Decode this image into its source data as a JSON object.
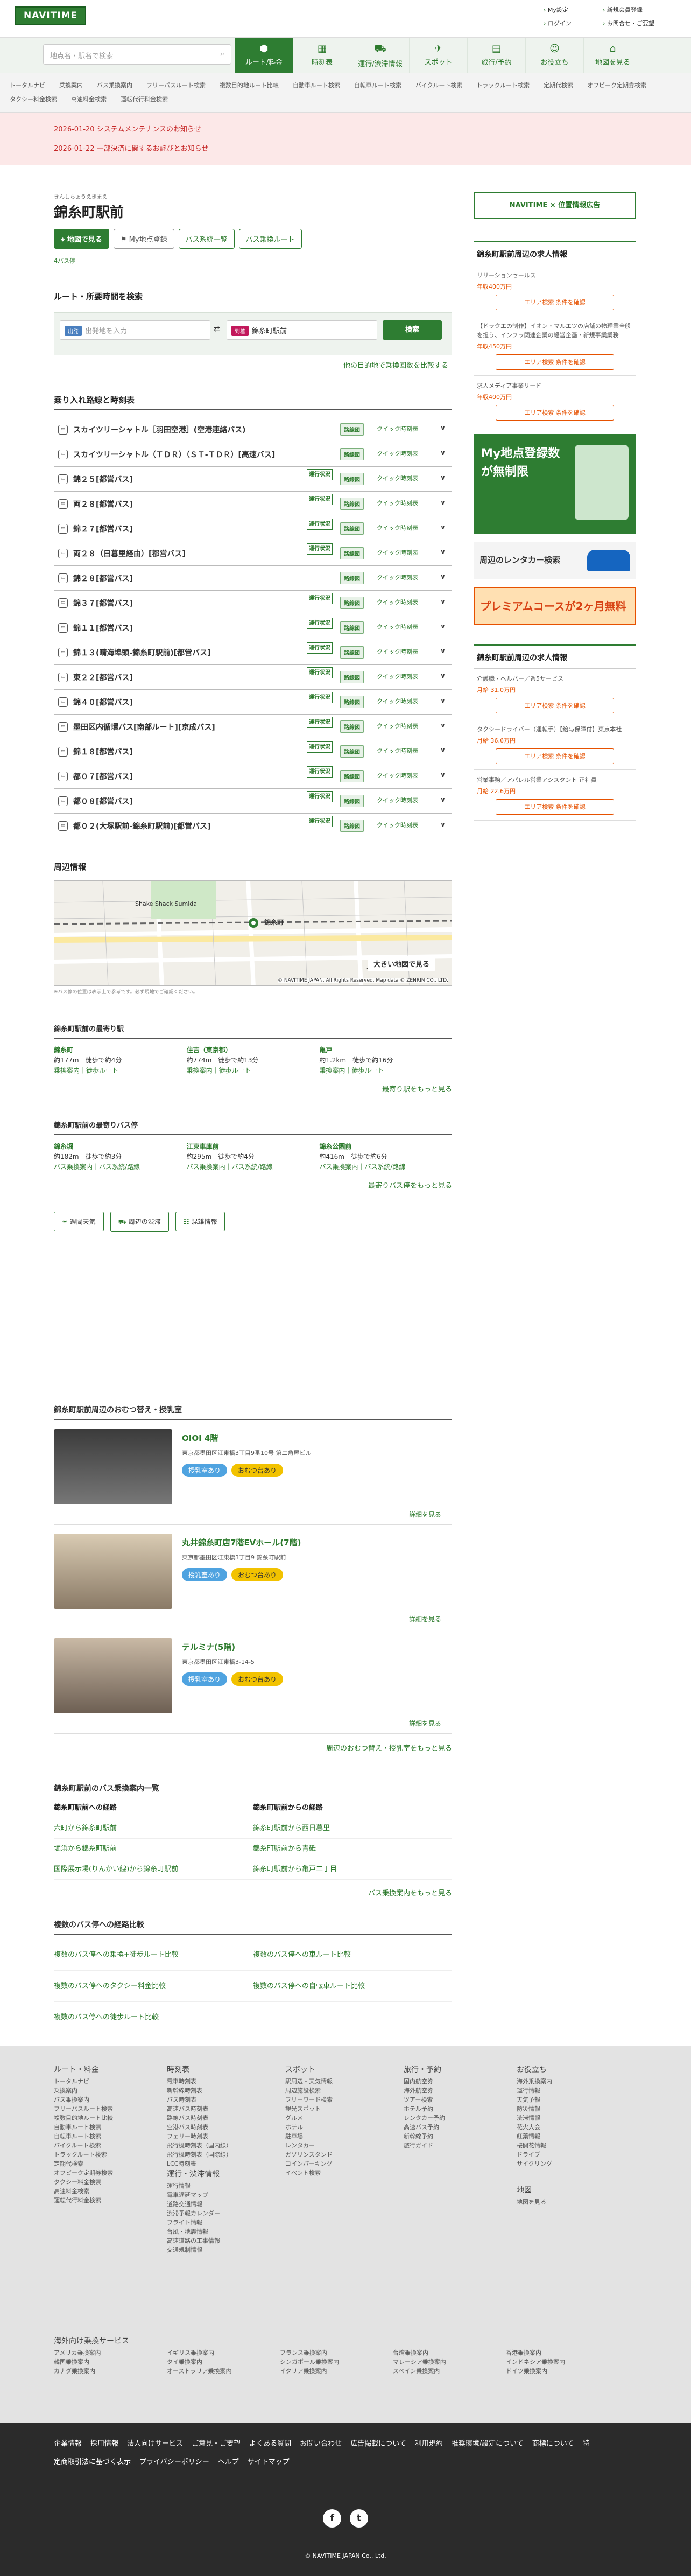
{
  "header": {
    "logo": "NAVITIME",
    "links": [
      "My設定",
      "新規会員登録",
      "ログイン",
      "お問合せ・ご要望"
    ]
  },
  "search": {
    "placeholder": "地点名・駅名で検索"
  },
  "nav": [
    {
      "label": "ルート/料金",
      "icon": "route-icon"
    },
    {
      "label": "時刻表",
      "icon": "timetable-icon"
    },
    {
      "label": "運行/渋滞情報",
      "icon": "traffic-icon"
    },
    {
      "label": "スポット",
      "icon": "spot-icon"
    },
    {
      "label": "旅行/予約",
      "icon": "travel-icon"
    },
    {
      "label": "お役立ち",
      "icon": "useful-icon"
    },
    {
      "label": "地図を見る",
      "icon": "map-icon"
    }
  ],
  "subnav": [
    "トータルナビ",
    "乗換案内",
    "バス乗換案内",
    "フリーパスルート検索",
    "複数目的地ルート比較",
    "自動車ルート検索",
    "自転車ルート検索",
    "バイクルート検索",
    "トラックルート検索",
    "定期代検索",
    "オフピーク定期券検索",
    "タクシー料金検索",
    "高速料金検索",
    "運転代行料金検索"
  ],
  "notices": [
    "2026-01-20 システムメンテナンスのお知らせ",
    "2026-01-22 一部決済に関するお詫びとお知らせ"
  ],
  "station": {
    "ruby": "きんしちょうえきまえ",
    "name": "錦糸町駅前",
    "btn_map": "地図で見る",
    "btn_my": "My地点登録",
    "btn_bus1": "バス系統一覧",
    "btn_bus2": "バス乗換ルート",
    "sub_link": "4バス停"
  },
  "route_search": {
    "title": "ルート・所要時間を検索",
    "from_tag": "出発",
    "from_ph": "出発地を入力",
    "to_tag": "到着",
    "to_val": "錦糸町駅前",
    "search": "検索",
    "compare": "他の目的地で乗換回数を比較する"
  },
  "lines_title": "乗り入れ路線と時刻表",
  "lines": [
    {
      "name": "スカイツリーシャトル［羽田空港］(空港連絡バス)",
      "ops": false
    },
    {
      "name": "スカイツリーシャトル（ＴＤＲ）（ＳＴ-ＴＤＲ）[高速バス]",
      "ops": false
    },
    {
      "name": "錦２５[都営バス]",
      "ops": true
    },
    {
      "name": "両２８[都営バス]",
      "ops": true
    },
    {
      "name": "錦２７[都営バス]",
      "ops": true
    },
    {
      "name": "両２８（日暮里経由）[都営バス]",
      "ops": true
    },
    {
      "name": "錦２８[都営バス]",
      "ops": false
    },
    {
      "name": "錦３７[都営バス]",
      "ops": true
    },
    {
      "name": "錦１１[都営バス]",
      "ops": true
    },
    {
      "name": "錦１３(晴海埠頭-錦糸町駅前)[都営バス]",
      "ops": true
    },
    {
      "name": "東２２[都営バス]",
      "ops": true
    },
    {
      "name": "錦４０[都営バス]",
      "ops": true
    },
    {
      "name": "墨田区内循環バス[南部ルート][京成バス]",
      "ops": true
    },
    {
      "name": "錦１８[都営バス]",
      "ops": true
    },
    {
      "name": "都０７[都営バス]",
      "ops": true
    },
    {
      "name": "都０８[都営バス]",
      "ops": true
    },
    {
      "name": "都０２(大塚駅前-錦糸町駅前)[都営バス]",
      "ops": true
    }
  ],
  "line_labels": {
    "ops": "運行状況",
    "sm": "路線図",
    "tt": "クイック時刻表",
    "cv": "∨"
  },
  "map": {
    "title": "周辺情報",
    "label1": "錦糸町",
    "label2": "Shake Shack Sumida",
    "label3": "大横",
    "bigbtn": "大きい地図で見る",
    "copyright": "© NAVITIME JAPAN, All Rights Reserved. Map data © ZENRIN CO., LTD.",
    "note": "※バス停の位置は表示上で参考です。必ず現地でご確認ください。"
  },
  "near_stations": {
    "title": "錦糸町駅前の最寄り駅",
    "items": [
      {
        "name": "錦糸町",
        "dist": "約177m　徒歩で約4分",
        "links": "乗換案内｜徒歩ルート"
      },
      {
        "name": "住吉（東京都）",
        "dist": "約774m　徒歩で約13分",
        "links": "乗換案内｜徒歩ルート"
      },
      {
        "name": "亀戸",
        "dist": "約1.2km　徒歩で約16分",
        "links": "乗換案内｜徒歩ルート"
      }
    ],
    "more": "最寄り駅をもっと見る"
  },
  "near_busstops": {
    "title": "錦糸町駅前の最寄りバス停",
    "items": [
      {
        "name": "錦糸堀",
        "dist": "約182m　徒歩で約3分",
        "links": "バス乗換案内｜バス系統/路線"
      },
      {
        "name": "江東車庫前",
        "dist": "約295m　徒歩で約4分",
        "links": "バス乗換案内｜バス系統/路線"
      },
      {
        "name": "錦糸公園前",
        "dist": "約416m　徒歩で約6分",
        "links": "バス乗換案内｜バス系統/路線"
      }
    ],
    "more": "最寄りバス停をもっと見る"
  },
  "info_buttons": [
    "週間天気",
    "周辺の渋滞",
    "混雑情報"
  ],
  "nursing": {
    "title": "錦糸町駅前周辺のおむつ替え・授乳室",
    "items": [
      {
        "name": "OIOI 4階",
        "addr": "東京都墨田区江東橋3丁目9番10号 第二角屋ビル"
      },
      {
        "name": "丸井錦糸町店7階EVホール(7階)",
        "addr": "東京都墨田区江東橋3丁目9 錦糸町駅前"
      },
      {
        "name": "テルミナ(5階)",
        "addr": "東京都墨田区江東橋3-14-5"
      }
    ],
    "tag1": "授乳室あり",
    "tag2": "おむつ台あり",
    "detail": "詳細を見る",
    "more": "周辺のおむつ替え・授乳室をもっと見る"
  },
  "bus_routes": {
    "title": "錦糸町駅前のバス乗換案内一覧",
    "h1": "錦糸町駅前への経路",
    "h2": "錦糸町駅前からの経路",
    "to": [
      "六町から錦糸町駅前",
      "堀浜から錦糸町駅前",
      "国際展示場(りんかい線)から錦糸町駅前"
    ],
    "from": [
      "錦糸町駅前から西日暮里",
      "錦糸町駅前から青砥",
      "錦糸町駅前から亀戸二丁目"
    ],
    "more": "バス乗換案内をもっと見る"
  },
  "multi": {
    "title": "複数のバス停への経路比較",
    "items": [
      "複数のバス停への乗換+徒歩ルート比較",
      "複数のバス停への車ルート比較",
      "複数のバス停へのタクシー料金比較",
      "複数のバス停への自転車ルート比較",
      "複数のバス停への徒歩ルート比較"
    ]
  },
  "side": {
    "ad_title": "NAVITIME × 位置情報広告",
    "jobs_title": "錦糸町駅前周辺の求人情報",
    "jobs": [
      {
        "desc": "リリーションセールス",
        "pay": "年収400万円"
      },
      {
        "desc": "【ドラクエの制作】イオン・マルエツの店舗の物理業全般を担う、インフラ関連企業の経営企画・新規事業業務",
        "pay": "年収450万円"
      },
      {
        "desc": "求人メディア事業リード",
        "pay": "年収400万円"
      }
    ],
    "jb": "エリア検索 条件を確認",
    "ad2": "My地点登録数が無制限",
    "ad3": "周辺のレンタカー検索",
    "ad4": "プレミアムコースが2ヶ月無料",
    "jobs2_title": "錦糸町駅前周辺の求人情報",
    "jobs2": [
      {
        "desc": "介護職・ヘルパー／週5サービス",
        "pay": "月給 31.0万円"
      },
      {
        "desc": "タクシードライバー（運転手）【給与保障付】東京本社",
        "pay": "月給 36.6万円"
      },
      {
        "desc": "営業事務／アパレル営業アシスタント 正社員",
        "pay": "月給 22.6万円"
      }
    ]
  },
  "footer": {
    "cols": [
      {
        "h": "ルート・料金",
        "items": [
          "トータルナビ",
          "乗換案内",
          "バス乗換案内",
          "フリーパスルート検索",
          "複数目的地ルート比較",
          "自動車ルート検索",
          "自転車ルート検索",
          "バイクルート検索",
          "トラックルート検索",
          "定期代検索",
          "オフピーク定期券検索",
          "タクシー料金検索",
          "高速料金検索",
          "運転代行料金検索"
        ]
      },
      {
        "h": "時刻表",
        "items": [
          "電車時刻表",
          "新幹線時刻表",
          "バス時刻表",
          "高速バス時刻表",
          "路線バス時刻表",
          "空港バス時刻表",
          "フェリー時刻表",
          "飛行機時刻表（国内線）",
          "飛行機時刻表（国際線）",
          "LCC時刻表"
        ]
      },
      {
        "h": "スポット",
        "items": [
          "駅周辺・天気情報",
          "周辺施設検索",
          "フリーワード検索",
          "観光スポット",
          "グルメ",
          "ホテル",
          "駐車場",
          "レンタカー",
          "ガソリンスタンド",
          "コインパーキング",
          "イベント検索"
        ]
      },
      {
        "h": "旅行・予約",
        "items": [
          "国内航空券",
          "海外航空券",
          "ツアー検索",
          "ホテル予約",
          "レンタカー予約",
          "高速バス予約",
          "新幹線予約",
          "旅行ガイド"
        ]
      },
      {
        "h": "お役立ち",
        "items": [
          "海外乗換案内",
          "運行情報",
          "天気予報",
          "防災情報",
          "渋滞情報",
          "花火大会",
          "紅葉情報",
          "桜開花情報",
          "ドライブ",
          "サイクリング"
        ]
      }
    ],
    "col2b": {
      "h": "運行・渋滞情報",
      "items": [
        "運行情報",
        "電車遅延マップ",
        "道路交通情報",
        "渋滞予報カレンダー",
        "フライト情報",
        "台風・地震情報",
        "高速道路の工事情報",
        "交通規制情報"
      ]
    },
    "map": {
      "h": "地図",
      "items": [
        "地図を見る"
      ]
    },
    "overseas": {
      "h": "海外向け乗換サービス",
      "items": [
        "アメリカ乗換案内",
        "イギリス乗換案内",
        "フランス乗換案内",
        "台湾乗換案内",
        "香港乗換案内",
        "韓国乗換案内",
        "タイ乗換案内",
        "シンガポール乗換案内",
        "マレーシア乗換案内",
        "インドネシア乗換案内",
        "カナダ乗換案内",
        "オーストラリア乗換案内",
        "イタリア乗換案内",
        "スペイン乗換案内",
        "ドイツ乗換案内"
      ]
    },
    "links": [
      "企業情報",
      "採用情報",
      "法人向けサービス",
      "ご意見・ご要望",
      "よくある質問",
      "お問い合わせ",
      "広告掲載について",
      "利用規約",
      "推奨環境/設定について",
      "商標について",
      "特定商取引法に基づく表示",
      "プライバシーポリシー",
      "ヘルプ",
      "サイトマップ"
    ],
    "copyright": "© NAVITIME JAPAN Co., Ltd."
  },
  "colors": {
    "brand": "#2e7d32",
    "notice": "#c62828",
    "job": "#e65100"
  }
}
